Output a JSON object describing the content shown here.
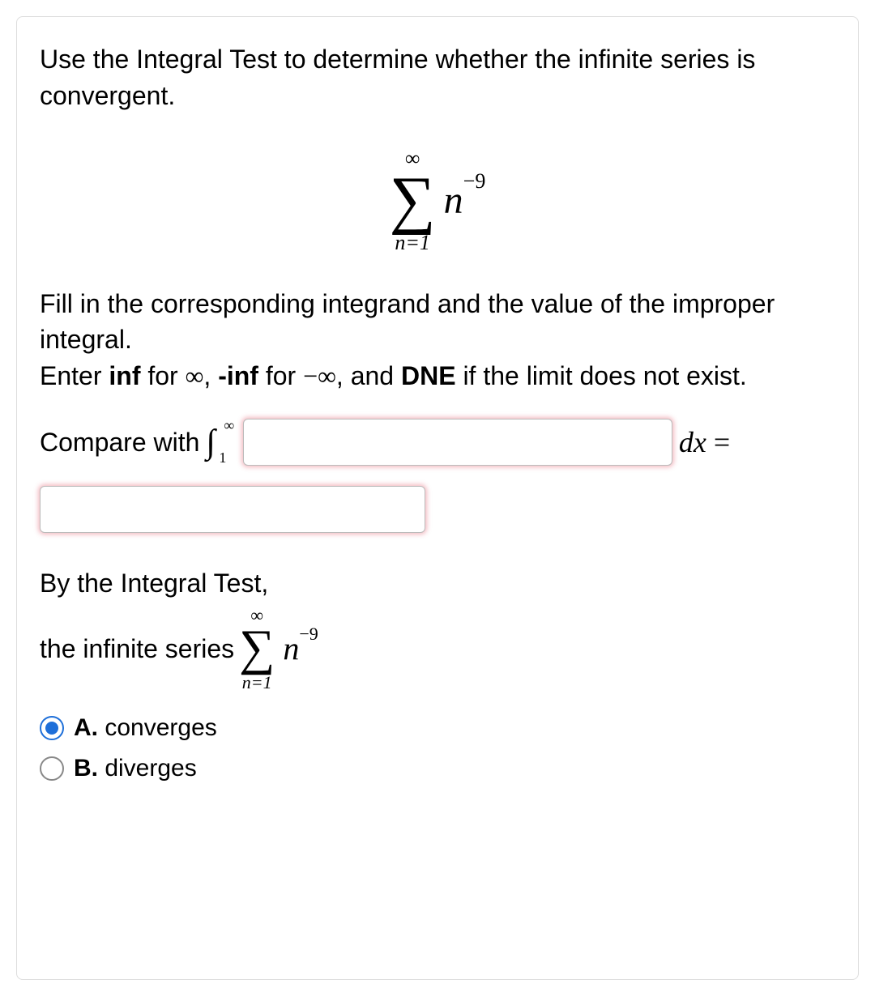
{
  "question": {
    "prompt": "Use the Integral Test to determine whether the infinite series is convergent.",
    "series": {
      "upper": "∞",
      "lower": "n=1",
      "term_base": "n",
      "term_exp": "−9"
    },
    "instructions_1": "Fill in the corresponding integrand and the value of the improper integral.",
    "instructions_2a": "Enter ",
    "inf_word": "inf",
    "instructions_2b": " for ",
    "inf_sym": "∞",
    "instructions_2c": ", ",
    "neg_inf_word": "-inf",
    "instructions_2d": " for ",
    "neg_inf_sym": "−∞",
    "instructions_2e": ", and ",
    "dne_word": "DNE",
    "instructions_2f": " if the limit does not exist.",
    "compare_label": "Compare with ",
    "integral": {
      "lower": "1",
      "upper": "∞"
    },
    "dx_label": "dx",
    "equals": " = ",
    "byline": "By the Integral Test,",
    "series_label": "the infinite series ",
    "options": {
      "a_letter": "A.",
      "a_text": " converges",
      "b_letter": "B.",
      "b_text": " diverges",
      "selected": "A"
    }
  },
  "inputs": {
    "integrand_value": "",
    "integral_value": ""
  }
}
